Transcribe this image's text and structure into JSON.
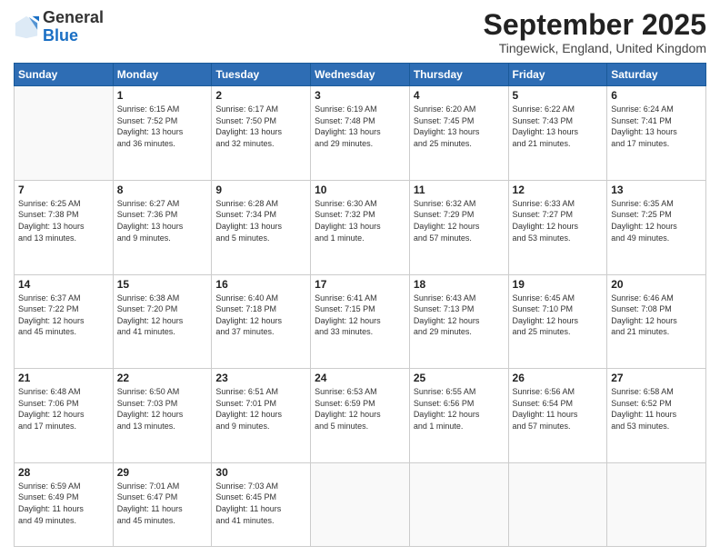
{
  "logo": {
    "general": "General",
    "blue": "Blue"
  },
  "header": {
    "month": "September 2025",
    "location": "Tingewick, England, United Kingdom"
  },
  "days_of_week": [
    "Sunday",
    "Monday",
    "Tuesday",
    "Wednesday",
    "Thursday",
    "Friday",
    "Saturday"
  ],
  "weeks": [
    [
      {
        "day": "",
        "info": ""
      },
      {
        "day": "1",
        "info": "Sunrise: 6:15 AM\nSunset: 7:52 PM\nDaylight: 13 hours\nand 36 minutes."
      },
      {
        "day": "2",
        "info": "Sunrise: 6:17 AM\nSunset: 7:50 PM\nDaylight: 13 hours\nand 32 minutes."
      },
      {
        "day": "3",
        "info": "Sunrise: 6:19 AM\nSunset: 7:48 PM\nDaylight: 13 hours\nand 29 minutes."
      },
      {
        "day": "4",
        "info": "Sunrise: 6:20 AM\nSunset: 7:45 PM\nDaylight: 13 hours\nand 25 minutes."
      },
      {
        "day": "5",
        "info": "Sunrise: 6:22 AM\nSunset: 7:43 PM\nDaylight: 13 hours\nand 21 minutes."
      },
      {
        "day": "6",
        "info": "Sunrise: 6:24 AM\nSunset: 7:41 PM\nDaylight: 13 hours\nand 17 minutes."
      }
    ],
    [
      {
        "day": "7",
        "info": "Sunrise: 6:25 AM\nSunset: 7:38 PM\nDaylight: 13 hours\nand 13 minutes."
      },
      {
        "day": "8",
        "info": "Sunrise: 6:27 AM\nSunset: 7:36 PM\nDaylight: 13 hours\nand 9 minutes."
      },
      {
        "day": "9",
        "info": "Sunrise: 6:28 AM\nSunset: 7:34 PM\nDaylight: 13 hours\nand 5 minutes."
      },
      {
        "day": "10",
        "info": "Sunrise: 6:30 AM\nSunset: 7:32 PM\nDaylight: 13 hours\nand 1 minute."
      },
      {
        "day": "11",
        "info": "Sunrise: 6:32 AM\nSunset: 7:29 PM\nDaylight: 12 hours\nand 57 minutes."
      },
      {
        "day": "12",
        "info": "Sunrise: 6:33 AM\nSunset: 7:27 PM\nDaylight: 12 hours\nand 53 minutes."
      },
      {
        "day": "13",
        "info": "Sunrise: 6:35 AM\nSunset: 7:25 PM\nDaylight: 12 hours\nand 49 minutes."
      }
    ],
    [
      {
        "day": "14",
        "info": "Sunrise: 6:37 AM\nSunset: 7:22 PM\nDaylight: 12 hours\nand 45 minutes."
      },
      {
        "day": "15",
        "info": "Sunrise: 6:38 AM\nSunset: 7:20 PM\nDaylight: 12 hours\nand 41 minutes."
      },
      {
        "day": "16",
        "info": "Sunrise: 6:40 AM\nSunset: 7:18 PM\nDaylight: 12 hours\nand 37 minutes."
      },
      {
        "day": "17",
        "info": "Sunrise: 6:41 AM\nSunset: 7:15 PM\nDaylight: 12 hours\nand 33 minutes."
      },
      {
        "day": "18",
        "info": "Sunrise: 6:43 AM\nSunset: 7:13 PM\nDaylight: 12 hours\nand 29 minutes."
      },
      {
        "day": "19",
        "info": "Sunrise: 6:45 AM\nSunset: 7:10 PM\nDaylight: 12 hours\nand 25 minutes."
      },
      {
        "day": "20",
        "info": "Sunrise: 6:46 AM\nSunset: 7:08 PM\nDaylight: 12 hours\nand 21 minutes."
      }
    ],
    [
      {
        "day": "21",
        "info": "Sunrise: 6:48 AM\nSunset: 7:06 PM\nDaylight: 12 hours\nand 17 minutes."
      },
      {
        "day": "22",
        "info": "Sunrise: 6:50 AM\nSunset: 7:03 PM\nDaylight: 12 hours\nand 13 minutes."
      },
      {
        "day": "23",
        "info": "Sunrise: 6:51 AM\nSunset: 7:01 PM\nDaylight: 12 hours\nand 9 minutes."
      },
      {
        "day": "24",
        "info": "Sunrise: 6:53 AM\nSunset: 6:59 PM\nDaylight: 12 hours\nand 5 minutes."
      },
      {
        "day": "25",
        "info": "Sunrise: 6:55 AM\nSunset: 6:56 PM\nDaylight: 12 hours\nand 1 minute."
      },
      {
        "day": "26",
        "info": "Sunrise: 6:56 AM\nSunset: 6:54 PM\nDaylight: 11 hours\nand 57 minutes."
      },
      {
        "day": "27",
        "info": "Sunrise: 6:58 AM\nSunset: 6:52 PM\nDaylight: 11 hours\nand 53 minutes."
      }
    ],
    [
      {
        "day": "28",
        "info": "Sunrise: 6:59 AM\nSunset: 6:49 PM\nDaylight: 11 hours\nand 49 minutes."
      },
      {
        "day": "29",
        "info": "Sunrise: 7:01 AM\nSunset: 6:47 PM\nDaylight: 11 hours\nand 45 minutes."
      },
      {
        "day": "30",
        "info": "Sunrise: 7:03 AM\nSunset: 6:45 PM\nDaylight: 11 hours\nand 41 minutes."
      },
      {
        "day": "",
        "info": ""
      },
      {
        "day": "",
        "info": ""
      },
      {
        "day": "",
        "info": ""
      },
      {
        "day": "",
        "info": ""
      }
    ]
  ]
}
